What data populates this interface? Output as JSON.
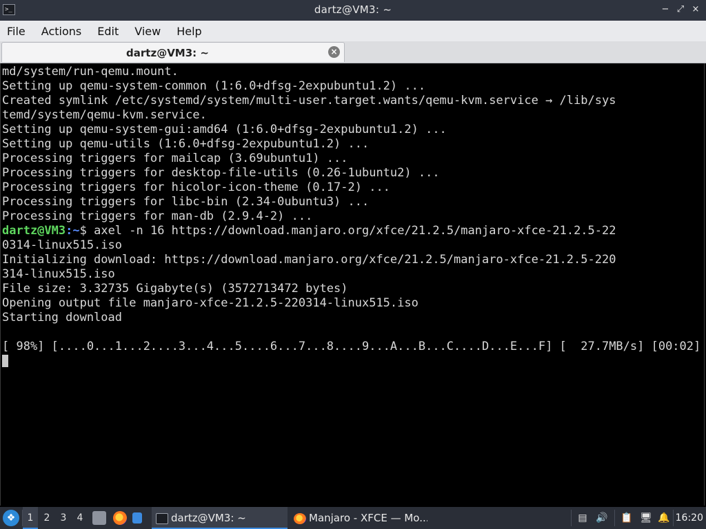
{
  "window": {
    "title": "dartz@VM3: ~",
    "controls": {
      "minimize": "−",
      "maximize": "⤢",
      "close": "×"
    }
  },
  "menu": {
    "items": [
      "File",
      "Actions",
      "Edit",
      "View",
      "Help"
    ]
  },
  "tab": {
    "label": "dartz@VM3: ~",
    "close": "×"
  },
  "terminal": {
    "lines_before": [
      "md/system/run-qemu.mount.",
      "Setting up qemu-system-common (1:6.0+dfsg-2expubuntu1.2) ...",
      "Created symlink /etc/systemd/system/multi-user.target.wants/qemu-kvm.service → /lib/sys",
      "temd/system/qemu-kvm.service.",
      "Setting up qemu-system-gui:amd64 (1:6.0+dfsg-2expubuntu1.2) ...",
      "Setting up qemu-utils (1:6.0+dfsg-2expubuntu1.2) ...",
      "Processing triggers for mailcap (3.69ubuntu1) ...",
      "Processing triggers for desktop-file-utils (0.26-1ubuntu2) ...",
      "Processing triggers for hicolor-icon-theme (0.17-2) ...",
      "Processing triggers for libc-bin (2.34-0ubuntu3) ...",
      "Processing triggers for man-db (2.9.4-2) ..."
    ],
    "prompt_user": "dartz@VM3",
    "prompt_path": ":~",
    "prompt_symbol": "$ ",
    "command": "axel -n 16 https://download.manjaro.org/xfce/21.2.5/manjaro-xfce-21.2.5-22",
    "lines_after": [
      "0314-linux515.iso",
      "Initializing download: https://download.manjaro.org/xfce/21.2.5/manjaro-xfce-21.2.5-220",
      "314-linux515.iso",
      "File size: 3.32735 Gigabyte(s) (3572713472 bytes)",
      "Opening output file manjaro-xfce-21.2.5-220314-linux515.iso",
      "Starting download",
      "",
      "[ 98%] [....0...1...2....3...4...5....6...7...8....9...A...B...C....D...E...F] [  27.7MB/s] [00:02]"
    ],
    "progress_percent": 98
  },
  "taskbar": {
    "workspaces": [
      "1",
      "2",
      "3",
      "4"
    ],
    "active_workspace": "1",
    "tasks": [
      {
        "label": "dartz@VM3: ~",
        "icon": "terminal-icon"
      },
      {
        "label": "Manjaro - XFCE — Mo...",
        "icon": "firefox-icon"
      }
    ],
    "clock": "16:20"
  },
  "colors": {
    "prompt_user": "#5fd75f",
    "prompt_path": "#5b8dff",
    "taskbar_accent": "#3c8be0"
  }
}
